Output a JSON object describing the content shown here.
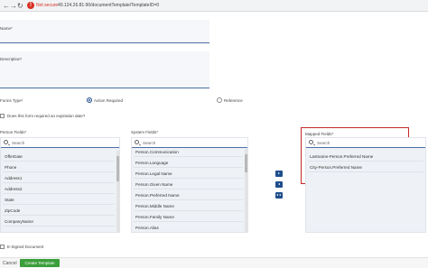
{
  "browser": {
    "security": "Not secure",
    "url": "40.124.26.81:90/documentTemplate/TemplateID=0"
  },
  "form": {
    "name_label": "Name*",
    "description_label": "Description*",
    "forms_type_label": "Forms Type*",
    "radio_action_required": "Action Required",
    "radio_reference": "Reference",
    "expiration_label": "Does this form required an expiration date?"
  },
  "person_fields": {
    "label": "Person Fields*",
    "search_placeholder": "Search",
    "items": [
      "OfferDate",
      "Phone",
      "Address1",
      "Address2",
      "State",
      "ZipCode",
      "CompanyName"
    ]
  },
  "system_fields": {
    "label": "System Fields*",
    "search_placeholder": "Search",
    "items": [
      "Person.Communication",
      "Person.Language",
      "Person.Legal Name",
      "Person.Given Name",
      "Person.Preferred Name",
      "Person.Middle Name",
      "Person.Family Name",
      "Person.Alias"
    ]
  },
  "mapped_fields": {
    "label": "Mapped Fields*",
    "search_placeholder": "Search",
    "items": [
      "Lastname-Person.Preferred Name",
      "City-Person.Preferred Name"
    ]
  },
  "esigned_label": "E-Signed Document",
  "footer": {
    "cancel": "Cancel",
    "create": "Create Template"
  },
  "colors": {
    "accent": "#1f4e8c",
    "highlight_box": "#c62828",
    "create_button": "#3a9e3a"
  }
}
